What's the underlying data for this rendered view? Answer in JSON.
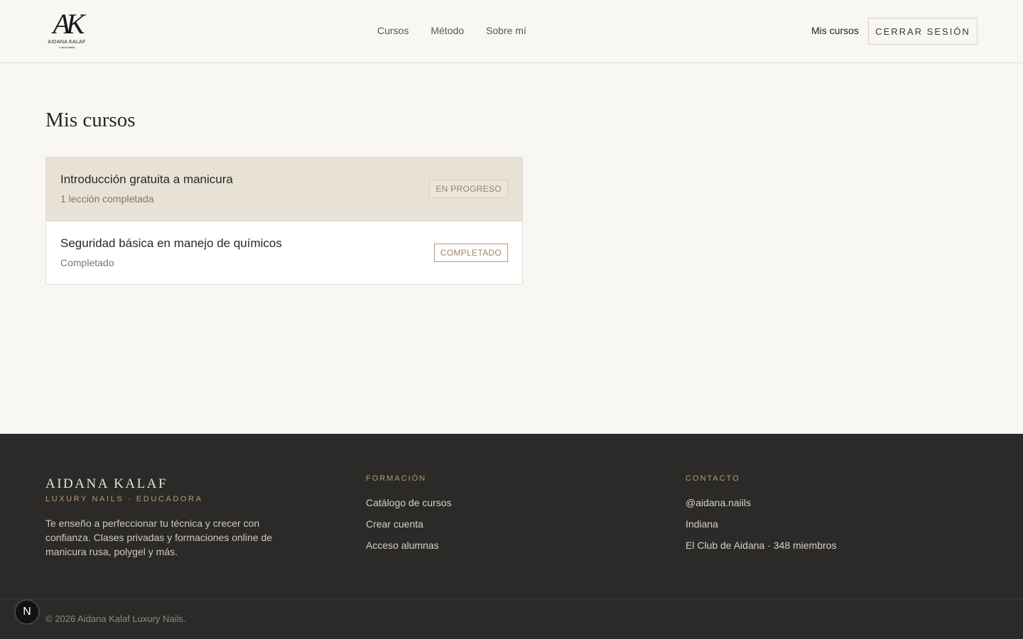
{
  "header": {
    "logo": {
      "mark": "AK",
      "name": "AIDANA KALAF",
      "sub": "Luxury Nails"
    },
    "nav": [
      {
        "label": "Cursos"
      },
      {
        "label": "Método"
      },
      {
        "label": "Sobre mí"
      }
    ],
    "my_courses_label": "Mis cursos",
    "logout_label": "CERRAR SESIÓN"
  },
  "main": {
    "title": "Mis cursos",
    "courses": [
      {
        "title": "Introducción gratuita a manicura",
        "subtitle": "1 lección completada",
        "status": "EN PROGRESO"
      },
      {
        "title": "Seguridad básica en manejo de químicos",
        "subtitle": "Completado",
        "status": "COMPLETADO"
      }
    ]
  },
  "footer": {
    "brand": "AIDANA KALAF",
    "tagline": "LUXURY NAILS · EDUCADORA",
    "description": "Te enseño a perfeccionar tu técnica y crecer con confianza. Clases privadas y formaciones online de manicura rusa, polygel y más.",
    "columns": [
      {
        "heading": "FORMACIÓN",
        "links": [
          "Catálogo de cursos",
          "Crear cuenta",
          "Acceso alumnas"
        ]
      },
      {
        "heading": "CONTACTO",
        "links": [
          "@aidana.naiils",
          "Indiana",
          "El Club de Aidana · 348 miembros"
        ]
      }
    ],
    "copyright": "© 2026 Aidana Kalaf Luxury Nails."
  },
  "floating_badge": "N",
  "colors": {
    "background": "#f8f7f3",
    "footer": "#2b2a28",
    "accent": "#b59b76",
    "active_card": "#e8e1d5"
  }
}
